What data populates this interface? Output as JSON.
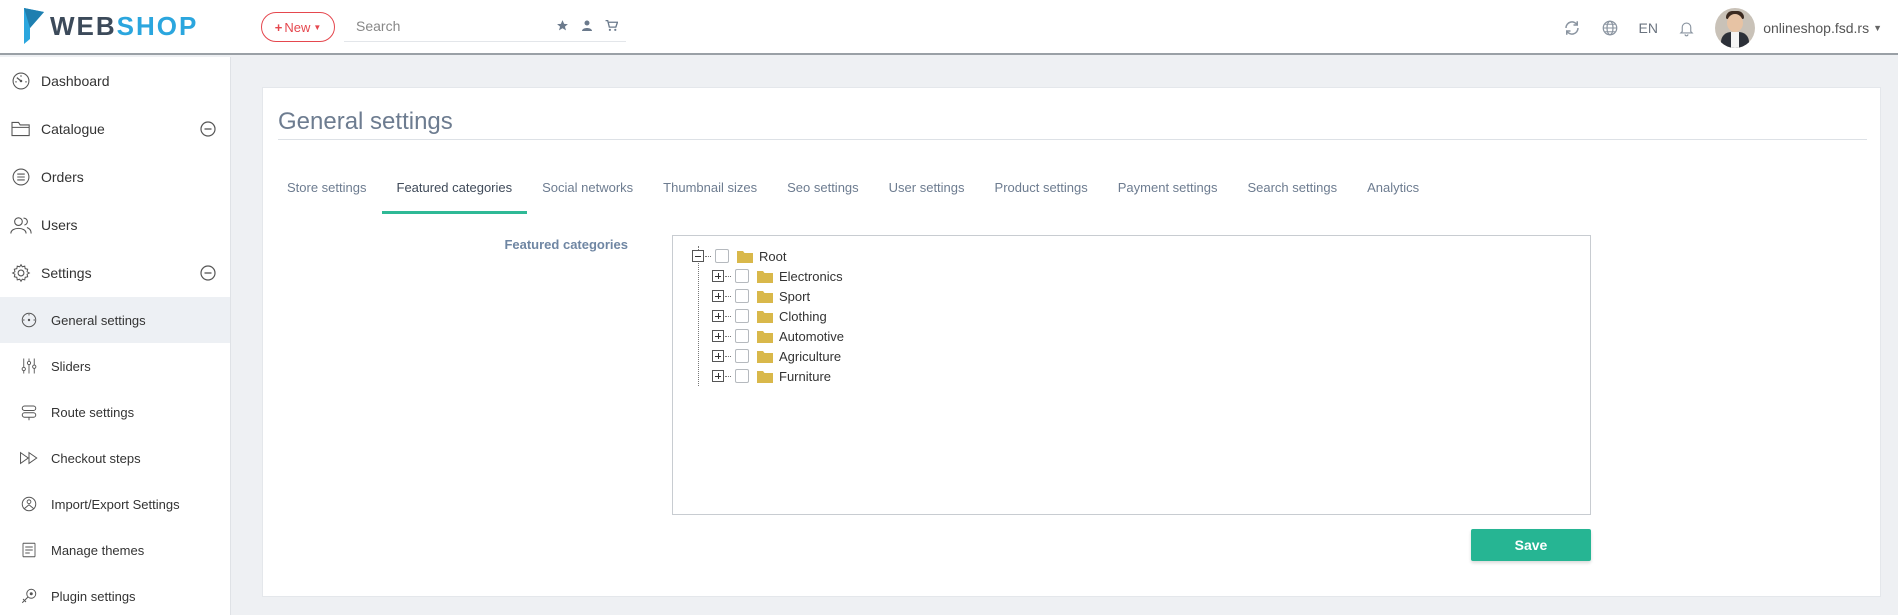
{
  "brand": {
    "part1": "WEB",
    "part2": "SHOP",
    "accent": "#2ba6de",
    "dark": "#3c4a5a"
  },
  "header": {
    "new_label": "New",
    "search_placeholder": "Search",
    "search_icons": [
      "star-icon",
      "user-icon",
      "cart-icon"
    ],
    "right_icons": [
      "refresh-icon",
      "globe-icon"
    ],
    "language": "EN",
    "notification_icon": "bell-icon",
    "user_name": "onlineshop.fsd.rs"
  },
  "sidebar": {
    "items": [
      {
        "label": "Dashboard",
        "icon": "dashboard-icon"
      },
      {
        "label": "Catalogue",
        "icon": "folder-icon",
        "collapsible": true
      },
      {
        "label": "Orders",
        "icon": "list-icon"
      },
      {
        "label": "Users",
        "icon": "users-icon"
      },
      {
        "label": "Settings",
        "icon": "gear-icon",
        "collapsible": true
      }
    ],
    "sub_items": [
      {
        "label": "General settings",
        "icon": "gauge-icon",
        "active": true
      },
      {
        "label": "Sliders",
        "icon": "sliders-icon"
      },
      {
        "label": "Route settings",
        "icon": "route-icon"
      },
      {
        "label": "Checkout steps",
        "icon": "fast-forward-icon"
      },
      {
        "label": "Import/Export Settings",
        "icon": "import-export-icon"
      },
      {
        "label": "Manage themes",
        "icon": "themes-icon"
      },
      {
        "label": "Plugin settings",
        "icon": "plugin-icon"
      }
    ]
  },
  "main": {
    "title": "General settings",
    "tabs": [
      {
        "label": "Store settings"
      },
      {
        "label": "Featured categories",
        "active": true
      },
      {
        "label": "Social networks"
      },
      {
        "label": "Thumbnail sizes"
      },
      {
        "label": "Seo settings"
      },
      {
        "label": "User settings"
      },
      {
        "label": "Product settings"
      },
      {
        "label": "Payment settings"
      },
      {
        "label": "Search settings"
      },
      {
        "label": "Analytics"
      }
    ],
    "field_label": "Featured categories",
    "tree": {
      "root": "Root",
      "children": [
        "Electronics",
        "Sport",
        "Clothing",
        "Automotive",
        "Agriculture",
        "Furniture"
      ]
    },
    "save_label": "Save"
  },
  "colors": {
    "accent_green": "#26b593",
    "new_red": "#e5474e",
    "folder": "#d9b84a",
    "title": "#6d7c90"
  }
}
